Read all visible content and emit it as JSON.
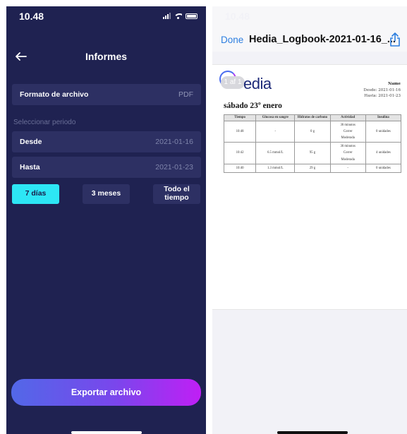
{
  "left_screen": {
    "status": {
      "time": "10.48"
    },
    "nav": {
      "title": "Informes"
    },
    "format_row": {
      "label": "Formato de archivo",
      "value": "PDF"
    },
    "period_section_label": "Seleccionar periodo",
    "from_row": {
      "label": "Desde",
      "value": "2021-01-16"
    },
    "to_row": {
      "label": "Hasta",
      "value": "2021-01-23"
    },
    "period_chips": [
      {
        "label": "7 días",
        "active": true
      },
      {
        "label": "3 meses",
        "active": false
      },
      {
        "label_line1": "Todo el",
        "label_line2": "tiempo",
        "active": false
      }
    ],
    "export_button": "Exportar archivo",
    "colors": {
      "background": "#1f2251",
      "row": "#2d3063",
      "accent": "#2de6f5"
    }
  },
  "right_screen": {
    "status": {
      "time": "10.48"
    },
    "toolbar": {
      "done_label": "Done",
      "file_name": "Hedia_Logbook-2021-01-16_..."
    },
    "pdf_page": {
      "page_badge": "1 af 1",
      "logo_text": "edia",
      "name_label": "Name",
      "desde": "Desde: 2021-01-16",
      "hasta": "Hasta: 2021-01-23",
      "date_heading": "sábado 23º enero",
      "table": {
        "headers": [
          "Tiempo",
          "Glucosa en sangre",
          "Hidratos de carbono",
          "Actividad",
          "Insulina"
        ],
        "rows": [
          {
            "time": "10:48",
            "glucose": "-",
            "carbs": "0 g",
            "activity": [
              "36 minutos",
              "Correr",
              "Moderada"
            ],
            "insulin": "0 unidades"
          },
          {
            "time": "10:42",
            "glucose": "6.5 mmol/L",
            "carbs": "95 g",
            "activity": [
              "36 minutos",
              "Correr",
              "Moderada"
            ],
            "insulin": "4 unidades"
          },
          {
            "time": "10:40",
            "glucose": "1.3 mmol/L",
            "carbs": "29 g",
            "activity": [
              "-"
            ],
            "insulin": "0 unidades"
          }
        ]
      }
    }
  }
}
